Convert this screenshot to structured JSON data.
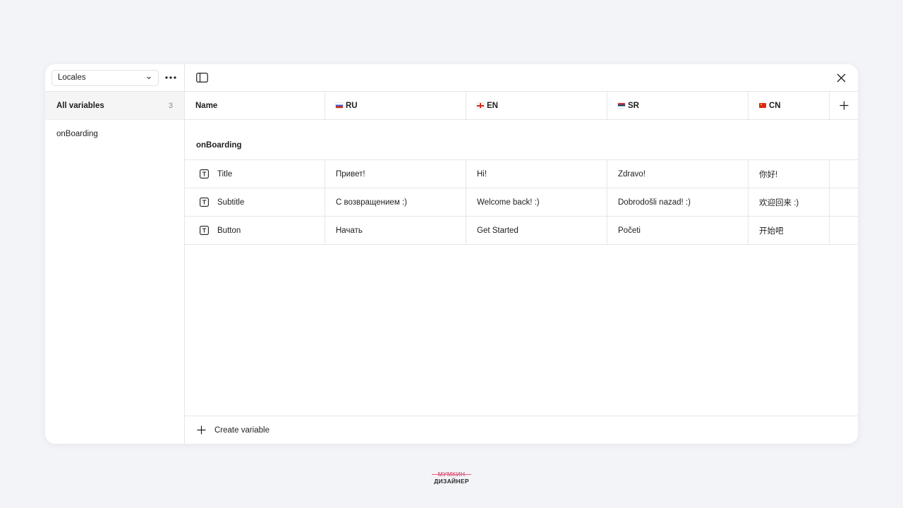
{
  "sidebar": {
    "collection_select": "Locales",
    "groups": [
      {
        "label": "All variables",
        "count": "3"
      },
      {
        "label": "onBoarding"
      }
    ]
  },
  "table": {
    "name_header": "Name",
    "languages": [
      {
        "code": "RU",
        "flag": "flag-ru"
      },
      {
        "code": "EN",
        "flag": "flag-en"
      },
      {
        "code": "SR",
        "flag": "flag-sr"
      },
      {
        "code": "CN",
        "flag": "flag-cn"
      }
    ],
    "group_label": "onBoarding",
    "rows": [
      {
        "name": "Title",
        "values": [
          "Привет!",
          "Hi!",
          "Zdravo!",
          "你好!"
        ]
      },
      {
        "name": "Subtitle",
        "values": [
          "С возвращением :)",
          "Welcome back! :)",
          "Dobrodošli nazad! :)",
          "欢迎回来 :)"
        ]
      },
      {
        "name": "Button",
        "values": [
          "Начать",
          "Get Started",
          "Početi",
          "开始吧"
        ]
      }
    ]
  },
  "footer": {
    "create_label": "Create variable"
  },
  "watermark": {
    "line1": "МУМКИН",
    "line2": "ДИЗАЙНЕР"
  },
  "colors": {
    "background": "#f3f4f8",
    "panel": "#ffffff",
    "border": "#e6e6e6",
    "watermark_accent": "#e0637f"
  }
}
